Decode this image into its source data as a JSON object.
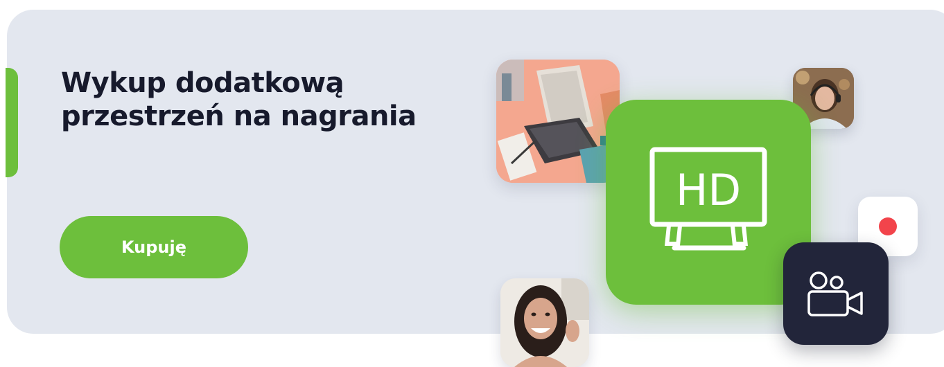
{
  "promo": {
    "headline": "Wykup dodatkową przestrzeń na nagrania",
    "cta_label": "Kupuję"
  },
  "hd_tile": {
    "icon": "hd-monitor-icon",
    "text": "HD"
  },
  "record_tile": {
    "icon": "record-dot-icon"
  },
  "camera_tile": {
    "icon": "video-camera-icon"
  },
  "images": [
    "desk-laptop-photo",
    "woman-with-headset-photo",
    "smiling-woman-waving-photo"
  ],
  "colors": {
    "accent_green": "#6dbf3c",
    "banner_bg": "#e3e7ef",
    "headline_text": "#171a2c",
    "dark_tile": "#22253a",
    "record_red": "#f2444b"
  }
}
